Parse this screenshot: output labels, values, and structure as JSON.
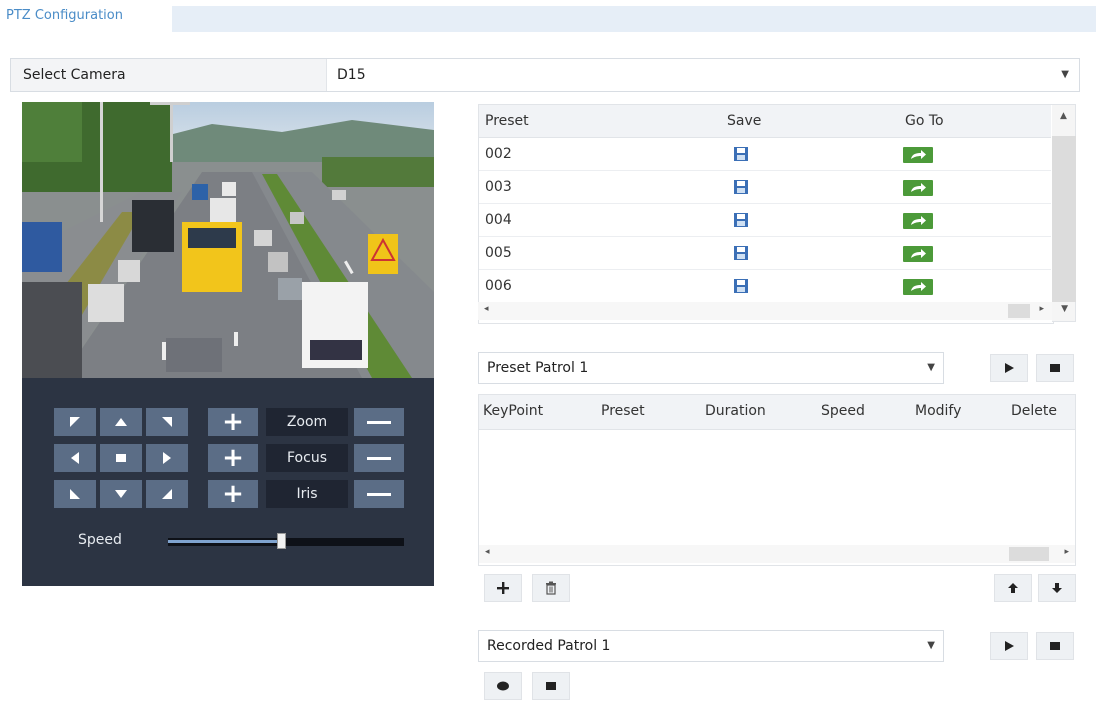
{
  "header": {
    "title": "PTZ Configuration"
  },
  "camera": {
    "label": "Select Camera",
    "value": "D15"
  },
  "ptz": {
    "zoom_label": "Zoom",
    "focus_label": "Focus",
    "iris_label": "Iris",
    "speed_label": "Speed",
    "speed_level": 0.48
  },
  "presets": {
    "headers": [
      "Preset",
      "Save",
      "Go To"
    ],
    "rows": [
      "002",
      "003",
      "004",
      "005",
      "006"
    ]
  },
  "preset_patrol": {
    "selected": "Preset Patrol 1",
    "table_headers": [
      "KeyPoint",
      "Preset",
      "Duration",
      "Speed",
      "Modify",
      "Delete"
    ]
  },
  "recorded_patrol": {
    "selected": "Recorded Patrol 1"
  },
  "colors": {
    "accent": "#4a8cc7",
    "ptz_panel": "#2c3443",
    "go_to_green": "#4c9a39"
  }
}
